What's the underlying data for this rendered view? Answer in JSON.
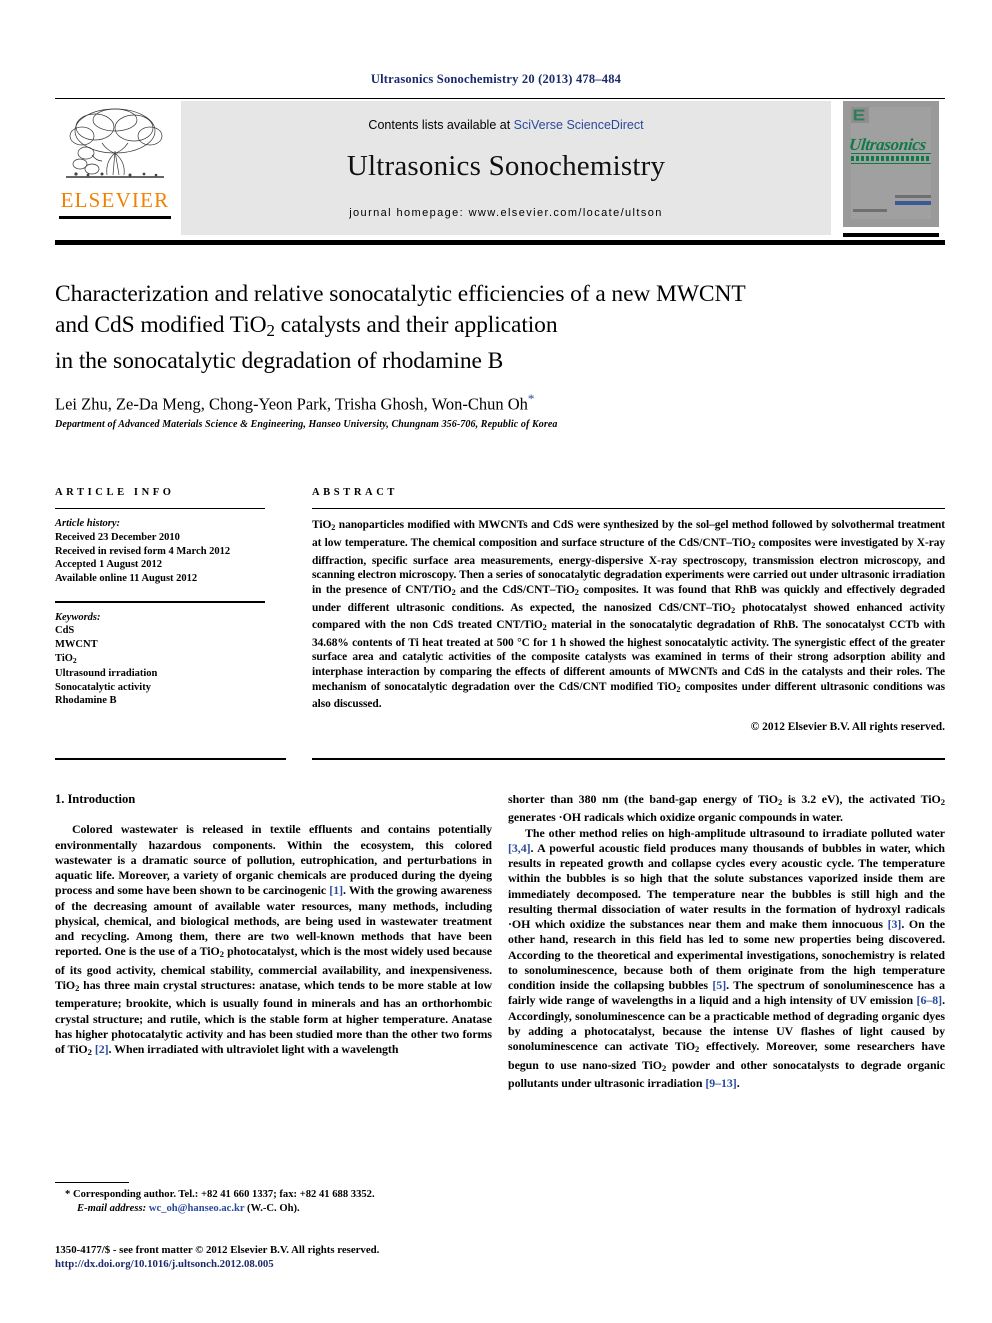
{
  "running_head": "Ultrasonics Sonochemistry 20 (2013) 478–484",
  "masthead": {
    "publisher_name": "ELSEVIER",
    "contents_prefix": "Contents lists available at ",
    "sciencedirect_link": "SciVerse ScienceDirect",
    "journal_title": "Ultrasonics Sonochemistry",
    "homepage": "journal homepage: www.elsevier.com/locate/ultson",
    "cover_title": "Ultrasonics"
  },
  "article": {
    "title_line1": "Characterization and relative sonocatalytic efficiencies of a new MWCNT",
    "title_line2_a": "and CdS modified TiO",
    "title_line2_sub": "2",
    "title_line2_b": " catalysts and their application",
    "title_line3": "in the sonocatalytic degradation of rhodamine B",
    "authors": "Lei Zhu, Ze-Da Meng, Chong-Yeon Park, Trisha Ghosh, Won-Chun Oh",
    "author_marker": "*",
    "affiliation": "Department of Advanced Materials Science & Engineering, Hanseo University, Chungnam 356-706, Republic of Korea"
  },
  "article_info": {
    "heading": "ARTICLE INFO",
    "history_label": "Article history:",
    "history": [
      "Received 23 December 2010",
      "Received in revised form 4 March 2012",
      "Accepted 1 August 2012",
      "Available online 11 August 2012"
    ],
    "keywords_label": "Keywords:",
    "keywords": [
      "CdS",
      "MWCNT",
      "TiO2",
      "Ultrasound irradiation",
      "Sonocatalytic activity",
      "Rhodamine B"
    ]
  },
  "abstract": {
    "heading": "ABSTRACT",
    "text": "TiO2 nanoparticles modified with MWCNTs and CdS were synthesized by the sol–gel method followed by solvothermal treatment at low temperature. The chemical composition and surface structure of the CdS/CNT–TiO2 composites were investigated by X-ray diffraction, specific surface area measurements, energy-dispersive X-ray spectroscopy, transmission electron microscopy, and scanning electron microscopy. Then a series of sonocatalytic degradation experiments were carried out under ultrasonic irradiation in the presence of CNT/TiO2 and the CdS/CNT–TiO2 composites. It was found that RhB was quickly and effectively degraded under different ultrasonic conditions. As expected, the nanosized CdS/CNT–TiO2 photocatalyst showed enhanced activity compared with the non CdS treated CNT/TiO2 material in the sonocatalytic degradation of RhB. The sonocatalyst CCTb with 34.68% contents of Ti heat treated at 500 °C for 1 h showed the highest sonocatalytic activity. The synergistic effect of the greater surface area and catalytic activities of the composite catalysts was examined in terms of their strong adsorption ability and interphase interaction by comparing the effects of different amounts of MWCNTs and CdS in the catalysts and their roles. The mechanism of sonocatalytic degradation over the CdS/CNT modified TiO2 composites under different ultrasonic conditions was also discussed.",
    "copyright": "© 2012 Elsevier B.V. All rights reserved."
  },
  "body": {
    "section1_heading": "1. Introduction",
    "left_para1_pre": "Colored wastewater is released in textile effluents and contains potentially environmentally hazardous components. Within the ecosystem, this colored wastewater is a dramatic source of pollution, eutrophication, and perturbations in aquatic life. Moreover, a variety of organic chemicals are produced during the dyeing process and some have been shown to be carcinogenic ",
    "ref1": "[1]",
    "left_para1_mid": ". With the growing awareness of the decreasing amount of available water resources, many methods, including physical, chemical, and biological methods, are being used in wastewater treatment and recycling. Among them, there are two well-known methods that have been reported. One is the use of a TiO2 photocatalyst, which is the most widely used because of its good activity, chemical stability, commercial availability, and inexpensiveness. TiO2 has three main crystal structures: anatase, which tends to be more stable at low temperature; brookite, which is usually found in minerals and has an orthorhombic crystal structure; and rutile, which is the stable form at higher temperature. Anatase has higher photocatalytic activity and has been studied more than the other two forms of TiO2 ",
    "ref2": "[2]",
    "left_para1_post": ". When irradiated with ultraviolet light with a wavelength",
    "right_para1_cont": "shorter than 380 nm (the band-gap energy of TiO2 is 3.2 eV), the activated TiO2 generates ·OH radicals which oxidize organic compounds in water.",
    "right_para2_a": "The other method relies on high-amplitude ultrasound to irradiate polluted water ",
    "ref34": "[3,4]",
    "right_para2_b": ". A powerful acoustic field produces many thousands of bubbles in water, which results in repeated growth and collapse cycles every acoustic cycle. The temperature within the bubbles is so high that the solute substances vaporized inside them are immediately decomposed. The temperature near the bubbles is still high and the resulting thermal dissociation of water results in the formation of hydroxyl radicals ·OH which oxidize the substances near them and make them innocuous ",
    "ref3": "[3]",
    "right_para2_c": ". On the other hand, research in this field has led to some new properties being discovered. According to the theoretical and experimental investigations, sonochemistry is related to sonoluminescence, because both of them originate from the high temperature condition inside the collapsing bubbles ",
    "ref5": "[5]",
    "right_para2_d": ". The spectrum of sonoluminescence has a fairly wide range of wavelengths in a liquid and a high intensity of UV emission ",
    "ref68": "[6–8]",
    "right_para2_e": ". Accordingly, sonoluminescence can be a practicable method of degrading organic dyes by adding a photocatalyst, because the intense UV flashes of light caused by sonoluminescence can activate TiO2 effectively. Moreover, some researchers have begun to use nano-sized TiO2 powder and other sonocatalysts to degrade organic pollutants under ultrasonic irradiation ",
    "ref913": "[9–13]",
    "right_para2_f": "."
  },
  "footer": {
    "corresponding_marker": "*",
    "corresponding_text": " Corresponding author. Tel.: +82 41 660 1337; fax: +82 41 688 3352.",
    "email_label": "E-mail address:",
    "email": "wc_oh@hanseo.ac.kr",
    "email_suffix": " (W.-C. Oh).",
    "issn_line": "1350-4177/$ - see front matter © 2012 Elsevier B.V. All rights reserved.",
    "doi": "http://dx.doi.org/10.1016/j.ultsonch.2012.08.005"
  },
  "colors": {
    "link_blue": "#2b4a9b",
    "head_navy": "#1b2a6b",
    "elsevier_orange": "#ef8200",
    "cover_green": "#0e7a47",
    "masthead_gray": "#e6e6e6"
  }
}
